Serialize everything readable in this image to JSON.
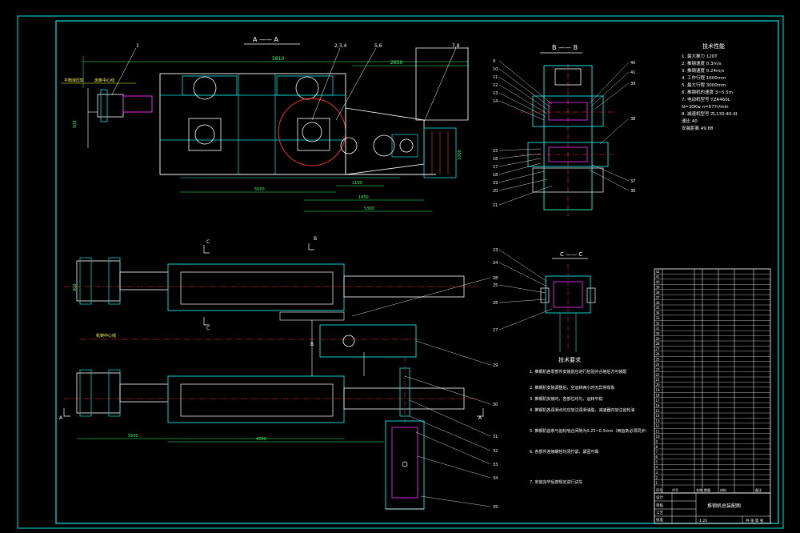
{
  "colors": {
    "background": "#000000",
    "frame": "#00e5e5",
    "outline": "#ffffff",
    "dimension": "#33ff66",
    "centerline": "#ff3333",
    "hidden": "#ffff00",
    "motor": "#ff33ff",
    "leader": "#ffffff"
  },
  "views": {
    "section_aa": "A —— A",
    "section_bb": "B —— B",
    "section_cc": "C —— C",
    "marker_c": "C",
    "marker_b": "B",
    "marker_a": "A"
  },
  "top_view": {
    "dims": [
      "5810",
      "5500",
      "2650",
      "1950",
      "1400",
      "1100",
      "250",
      "5300",
      "500",
      "1000"
    ],
    "callouts": [
      "1",
      "2,3,4",
      "5,6",
      "7,8"
    ],
    "notes": [
      "平衡液压缸",
      "齿条中心线"
    ]
  },
  "section_bb": {
    "callouts_left": [
      "9",
      "10",
      "11",
      "12",
      "13",
      "14",
      "15",
      "16",
      "17",
      "18",
      "19",
      "20",
      "21"
    ],
    "callouts_right": [
      "40",
      "41",
      "39",
      "38",
      "37",
      "36"
    ]
  },
  "section_cc": {
    "callouts": [
      "23",
      "24",
      "25",
      "26",
      "27"
    ]
  },
  "plan_view": {
    "dims": [
      "5500",
      "4700",
      "800"
    ],
    "callouts": [
      "28",
      "29",
      "30",
      "31",
      "32",
      "33",
      "34",
      "35"
    ],
    "note": "机架中心线"
  },
  "specs": {
    "title": "技术性能",
    "items": [
      "1. 最大推力 120T",
      "2. 推钢速度 0.3m/s",
      "3. 推钢速度 0.24m/s",
      "4. 工作行程 1600mm",
      "5. 最大行程 3000mm",
      "6. 推钢机的速度 3~5.5m",
      "7. 电动机型号 YZR460L",
      "   N=30Kw  n=577r/min",
      "8. 减速机型号 ZL130-40-III",
      "   速比 40",
      "   安装距离 49.88"
    ]
  },
  "requirements": {
    "title": "技术要求",
    "items": [
      "1. 推钢机各零部件安装前应进行检验并合格后方可装配",
      "2. 推钢机安装调整后，空运转两小时无异常现象",
      "3. 推钢机安装时，各部位均匀，运转平稳",
      "4. 推钢机各润滑点均应加注润滑油脂，减速器内加注齿轮油",
      "5. 推钢机齿条与齿轮啮合间隙为0.25~0.5mm（两齿条必须同步）",
      "6. 各部件连接螺栓均须拧紧，紧固可靠",
      "7. 安装完毕后按规定进行试车"
    ]
  },
  "bom": {
    "rows": [
      "42",
      "41",
      "40",
      "39",
      "38",
      "37",
      "36",
      "35",
      "34",
      "33",
      "32",
      "31",
      "30",
      "29",
      "28",
      "27",
      "26",
      "25",
      "24",
      "23",
      "22",
      "21",
      "20",
      "19",
      "18",
      "17",
      "16",
      "15",
      "14",
      "13",
      "12",
      "11",
      "10",
      "9",
      "8",
      "7",
      "6",
      "5",
      "4",
      "3",
      "2",
      "1"
    ],
    "header": [
      "序号",
      "代号",
      "名称",
      "数量",
      "材料",
      "备注"
    ]
  },
  "title_block": {
    "drawing_title": "推钢机总装配图",
    "scale": "1:20",
    "sheet": "共 张 第 张",
    "rows": [
      "设计",
      "审核",
      "工艺",
      "批准"
    ]
  }
}
